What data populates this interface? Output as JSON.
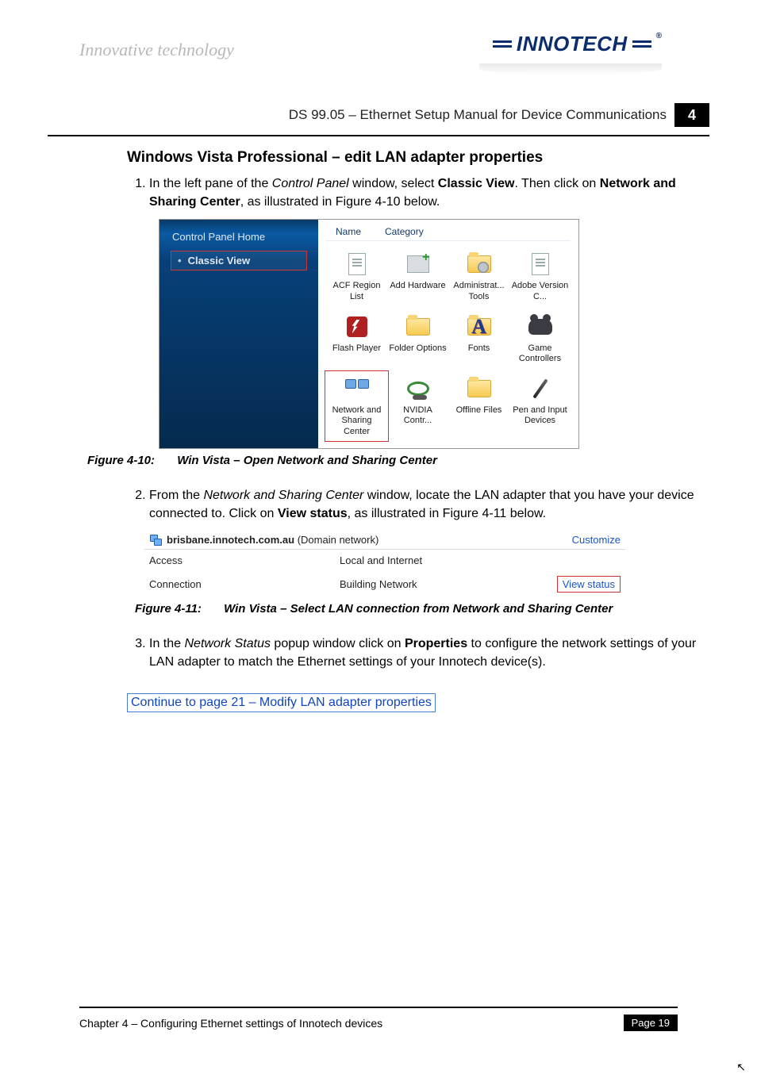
{
  "header": {
    "tagline": "Innovative technology",
    "brand": "INNOTECH",
    "doc_title": "DS 99.05 – Ethernet Setup Manual for Device Communications",
    "chapter_num": "4"
  },
  "section": {
    "heading": "Windows Vista Professional – edit LAN adapter properties",
    "step1_pre": "In the left pane of the ",
    "step1_cp": "Control Panel",
    "step1_mid": " window, select ",
    "step1_cv": "Classic View",
    "step1_mid2": ".  Then click on ",
    "step1_nsc": "Network and Sharing Center",
    "step1_post": ", as illustrated in Figure 4-10 below.",
    "step2_pre": "From the ",
    "step2_nsc": "Network and Sharing Center",
    "step2_mid": " window, locate the LAN adapter that you have your device connected to.  Click on ",
    "step2_vs": "View status",
    "step2_post": ", as illustrated in Figure 4-11 below.",
    "step3_pre": "In the ",
    "step3_ns": "Network Status",
    "step3_mid": " popup window click on ",
    "step3_prop": "Properties",
    "step3_post": " to configure the network settings of your LAN adapter to match the Ethernet settings of your Innotech device(s).",
    "link": "Continue to page 21 – Modify LAN adapter properties"
  },
  "fig10": {
    "label": "Figure 4-10:",
    "caption": "Win Vista – Open Network and Sharing Center",
    "side_home": "Control Panel Home",
    "side_classic": "Classic View",
    "col_name": "Name",
    "col_cat": "Category",
    "items": [
      "ACF Region List",
      "Add Hardware",
      "Administrat... Tools",
      "Adobe Version C...",
      "Flash Player",
      "Folder Options",
      "Fonts",
      "Game Controllers",
      "Network and Sharing Center",
      "NVIDIA Contr...",
      "Offline Files",
      "Pen and Input Devices"
    ]
  },
  "fig11": {
    "label": "Figure 4-11:",
    "caption": "Win Vista – Select LAN connection from Network and Sharing Center",
    "domain": "brisbane.innotech.com.au",
    "domain_suffix": " (Domain network)",
    "customize": "Customize",
    "access_lab": "Access",
    "access_val": "Local and Internet",
    "conn_lab": "Connection",
    "conn_val": "Building Network",
    "view_status": "View status"
  },
  "footer": {
    "chapter": "Chapter 4 – Configuring Ethernet settings of Innotech devices",
    "page": "Page 19"
  }
}
